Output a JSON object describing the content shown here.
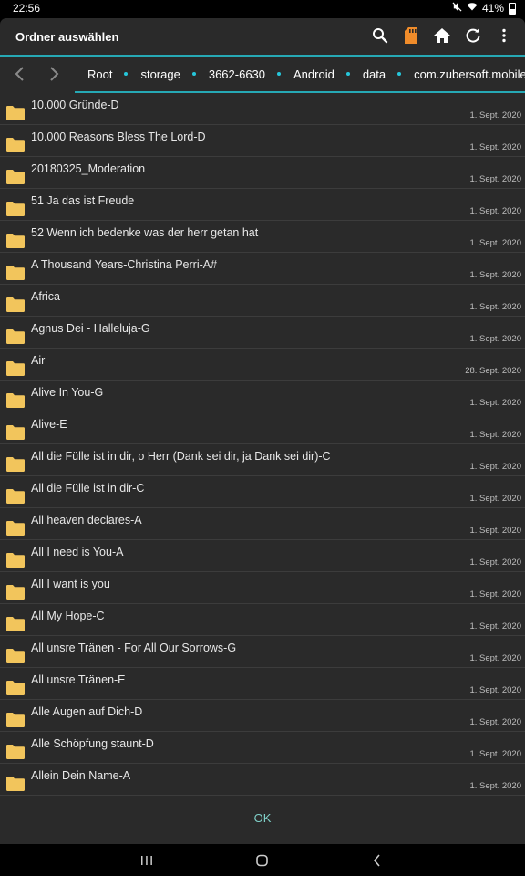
{
  "status": {
    "time": "22:56",
    "battery": "41%"
  },
  "dialog": {
    "title": "Ordner auswählen",
    "ok_label": "OK"
  },
  "breadcrumbs": [
    "Root",
    "storage",
    "3662-6630",
    "Android",
    "data",
    "com.zubersoft.mobilesheets"
  ],
  "toolbar_icons": [
    "search-icon",
    "sd-card-icon",
    "home-icon",
    "refresh-icon",
    "more-vert-icon"
  ],
  "colors": {
    "accent": "#26a9b5",
    "folder": "#f2c55c",
    "sd_card": "#f08c2a",
    "ok": "#7fd0c8"
  },
  "folders": [
    {
      "name": "10.000 Gründe-D",
      "date": "1. Sept. 2020"
    },
    {
      "name": "10.000 Reasons Bless The Lord-D",
      "date": "1. Sept. 2020"
    },
    {
      "name": "20180325_Moderation",
      "date": "1. Sept. 2020"
    },
    {
      "name": "51 Ja das ist Freude",
      "date": "1. Sept. 2020"
    },
    {
      "name": "52 Wenn ich bedenke was der herr getan hat",
      "date": "1. Sept. 2020"
    },
    {
      "name": "A Thousand Years-Christina Perri-A#",
      "date": "1. Sept. 2020"
    },
    {
      "name": "Africa",
      "date": "1. Sept. 2020"
    },
    {
      "name": "Agnus Dei - Halleluja-G",
      "date": "1. Sept. 2020"
    },
    {
      "name": "Air",
      "date": "28. Sept. 2020"
    },
    {
      "name": "Alive In You-G",
      "date": "1. Sept. 2020"
    },
    {
      "name": "Alive-E",
      "date": "1. Sept. 2020"
    },
    {
      "name": "All die Fülle ist in dir, o Herr (Dank sei dir, ja Dank sei dir)-C",
      "date": "1. Sept. 2020"
    },
    {
      "name": "All die Fülle ist in dir-C",
      "date": "1. Sept. 2020"
    },
    {
      "name": "All heaven declares-A",
      "date": "1. Sept. 2020"
    },
    {
      "name": "All I need is You-A",
      "date": "1. Sept. 2020"
    },
    {
      "name": "All I want is you",
      "date": "1. Sept. 2020"
    },
    {
      "name": "All My Hope-C",
      "date": "1. Sept. 2020"
    },
    {
      "name": "All unsre Tränen - For All Our Sorrows-G",
      "date": "1. Sept. 2020"
    },
    {
      "name": "All unsre Tränen-E",
      "date": "1. Sept. 2020"
    },
    {
      "name": "Alle Augen auf Dich-D",
      "date": "1. Sept. 2020"
    },
    {
      "name": "Alle Schöpfung staunt-D",
      "date": "1. Sept. 2020"
    },
    {
      "name": "Allein Dein Name-A",
      "date": "1. Sept. 2020"
    }
  ]
}
